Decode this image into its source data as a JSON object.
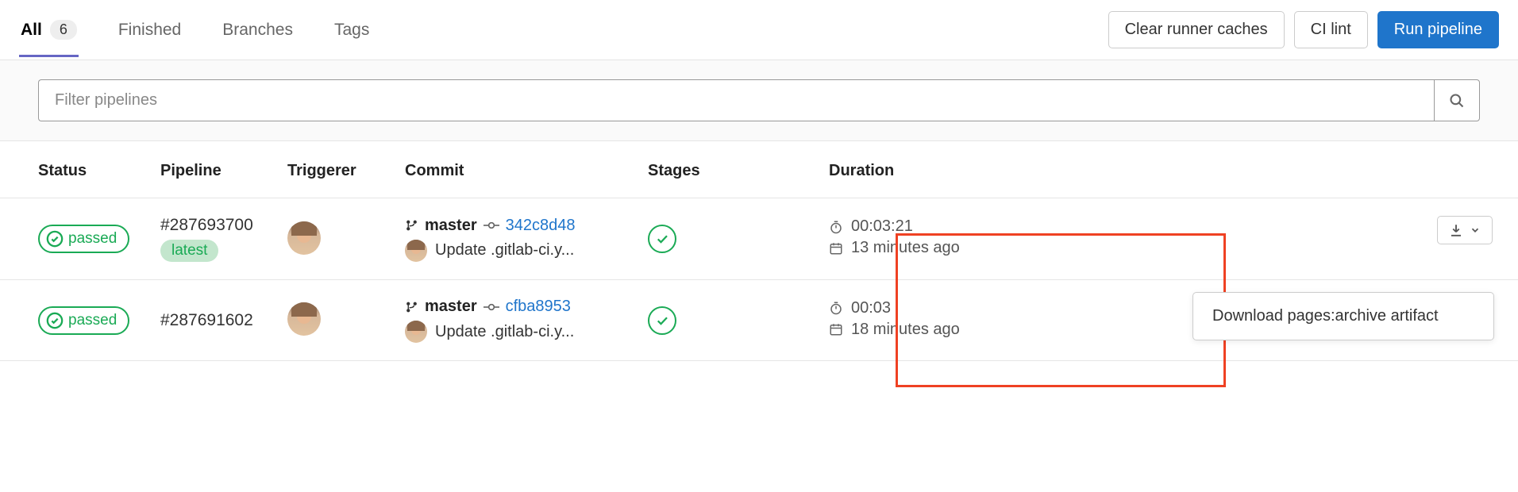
{
  "tabs": {
    "all": {
      "label": "All",
      "badge": "6"
    },
    "finished": {
      "label": "Finished"
    },
    "branches": {
      "label": "Branches"
    },
    "tags": {
      "label": "Tags"
    }
  },
  "actions": {
    "clear_caches": "Clear runner caches",
    "ci_lint": "CI lint",
    "run_pipeline": "Run pipeline"
  },
  "filter": {
    "placeholder": "Filter pipelines"
  },
  "columns": {
    "status": "Status",
    "pipeline": "Pipeline",
    "triggerer": "Triggerer",
    "commit": "Commit",
    "stages": "Stages",
    "duration": "Duration"
  },
  "status_label": "passed",
  "rows": [
    {
      "id": "#287693700",
      "tag": "latest",
      "branch": "master",
      "sha": "342c8d48",
      "message": "Update .gitlab-ci.y...",
      "duration": "00:03:21",
      "time_ago": "13 minutes ago"
    },
    {
      "id": "#287691602",
      "branch": "master",
      "sha": "cfba8953",
      "message": "Update .gitlab-ci.y...",
      "duration": "00:03",
      "time_ago": "18 minutes ago"
    }
  ],
  "dropdown": {
    "item": "Download pages:archive artifact"
  }
}
